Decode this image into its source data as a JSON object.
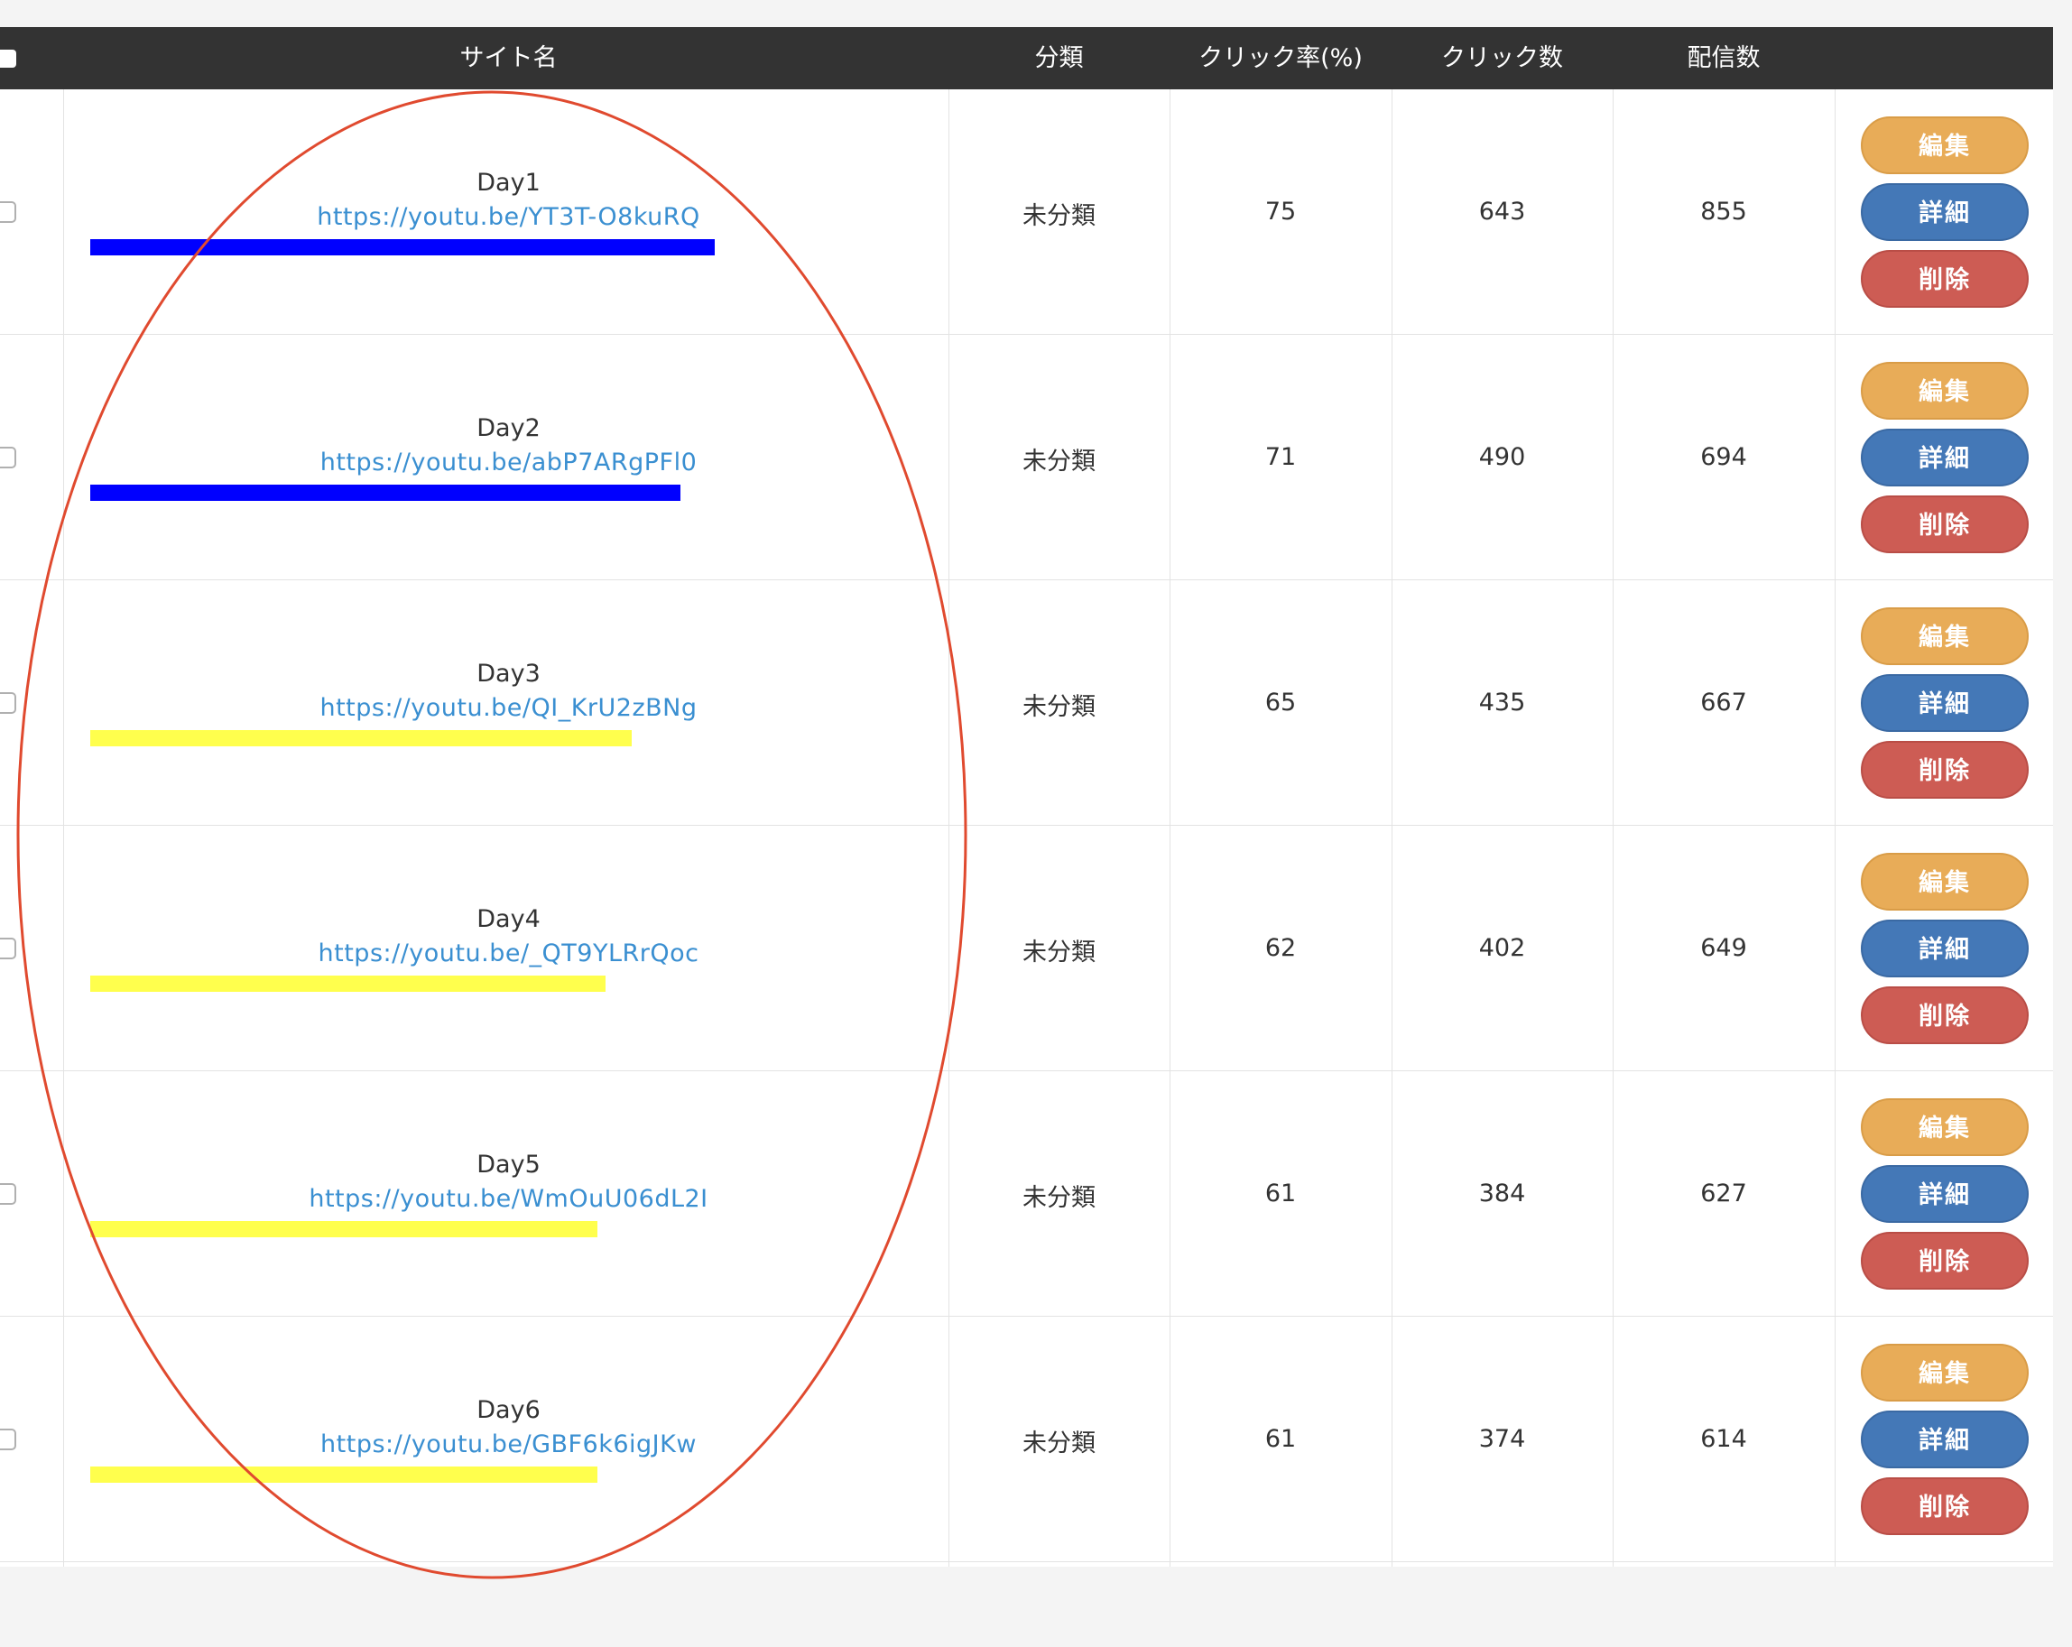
{
  "header": {
    "site_name": "サイト名",
    "category": "分類",
    "ctr": "クリック率(%)",
    "clicks": "クリック数",
    "deliveries": "配信数"
  },
  "buttons": {
    "edit": "編集",
    "detail": "詳細",
    "delete": "削除"
  },
  "colors": {
    "header_bg": "#333333",
    "link": "#3a8fd1",
    "edit": "#e8ac58",
    "detail": "#4478b7",
    "delete": "#cd5c54",
    "highlight_blue": "#0000ff",
    "highlight_yellow": "#ffff4d",
    "annotation_ellipse": "#e04a2f"
  },
  "rows": [
    {
      "title": "Day1",
      "url": "https://youtu.be/YT3T-O8kuRQ",
      "category": "未分類",
      "ctr": "75",
      "clicks": "643",
      "deliveries": "855",
      "highlight": "blue"
    },
    {
      "title": "Day2",
      "url": "https://youtu.be/abP7ARgPFl0",
      "category": "未分類",
      "ctr": "71",
      "clicks": "490",
      "deliveries": "694",
      "highlight": "blue"
    },
    {
      "title": "Day3",
      "url": "https://youtu.be/QI_KrU2zBNg",
      "category": "未分類",
      "ctr": "65",
      "clicks": "435",
      "deliveries": "667",
      "highlight": "yellow"
    },
    {
      "title": "Day4",
      "url": "https://youtu.be/_QT9YLRrQoc",
      "category": "未分類",
      "ctr": "62",
      "clicks": "402",
      "deliveries": "649",
      "highlight": "yellow"
    },
    {
      "title": "Day5",
      "url": "https://youtu.be/WmOuU06dL2I",
      "category": "未分類",
      "ctr": "61",
      "clicks": "384",
      "deliveries": "627",
      "highlight": "yellow"
    },
    {
      "title": "Day6",
      "url": "https://youtu.be/GBF6k6igJKw",
      "category": "未分類",
      "ctr": "61",
      "clicks": "374",
      "deliveries": "614",
      "highlight": "yellow"
    }
  ]
}
